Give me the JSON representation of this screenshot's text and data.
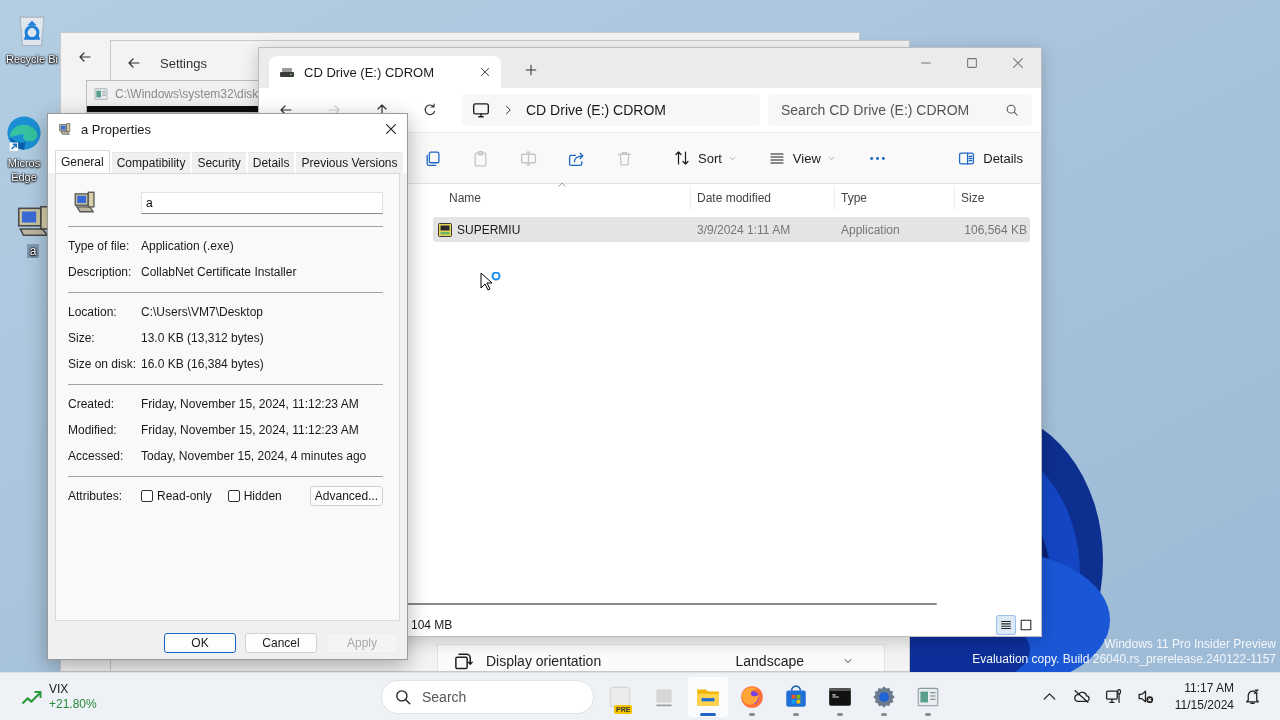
{
  "desktop_icons": [
    {
      "kind": "recycle",
      "label": "Recycle Bi"
    },
    {
      "kind": "edge",
      "label": "Micros Edge"
    },
    {
      "kind": "computer",
      "label": "a"
    }
  ],
  "settings_window": {
    "title": "Settings",
    "setting_row": {
      "label": "Display orientation",
      "value": "Landscape"
    }
  },
  "console_window": {
    "title": "C:\\Windows\\system32\\disk"
  },
  "explorer": {
    "tabs": [
      {
        "title": "CD Drive (E:) CDROM",
        "selected": true
      }
    ],
    "nav": [
      {
        "kind": "back",
        "disabled": false
      },
      {
        "kind": "forward",
        "disabled": true
      },
      {
        "kind": "up",
        "disabled": false
      },
      {
        "kind": "refresh",
        "disabled": false
      }
    ],
    "address": "CD Drive (E:) CDROM",
    "search": {
      "placeholder": "Search CD Drive (E:) CDROM"
    },
    "toolbar": [
      {
        "kind": "copy",
        "disabled": false
      },
      {
        "kind": "paste",
        "disabled": true
      },
      {
        "kind": "rename",
        "disabled": true
      },
      {
        "kind": "share",
        "disabled": false
      },
      {
        "kind": "delete",
        "disabled": true
      },
      {
        "kind": "sort",
        "label": "Sort",
        "disabled": false
      },
      {
        "kind": "view",
        "label": "View",
        "disabled": false
      },
      {
        "kind": "more",
        "disabled": false
      }
    ],
    "details_button": "Details",
    "columns": [
      "Name",
      "Date modified",
      "Type",
      "Size"
    ],
    "rows": [
      {
        "name": "SUPERMIU",
        "date": "3/9/2024 1:11 AM",
        "type": "Application",
        "size": "106,564 KB",
        "selected": true
      }
    ],
    "status_bar": "104 MB",
    "view_modes": [
      {
        "kind": "details",
        "selected": true
      },
      {
        "kind": "tiles",
        "selected": false
      }
    ]
  },
  "properties": {
    "title": "a Properties",
    "tabs": [
      {
        "label": "General",
        "selected": true
      },
      {
        "label": "Compatibility",
        "selected": false
      },
      {
        "label": "Security",
        "selected": false
      },
      {
        "label": "Details",
        "selected": false
      },
      {
        "label": "Previous Versions",
        "selected": false
      }
    ],
    "name": "a",
    "groups": [
      [
        {
          "label": "Type of file:",
          "value": "Application (.exe)"
        },
        {
          "label": "Description:",
          "value": "CollabNet Certificate Installer"
        }
      ],
      [
        {
          "label": "Location:",
          "value": "C:\\Users\\VM7\\Desktop"
        },
        {
          "label": "Size:",
          "value": "13.0 KB (13,312 bytes)"
        },
        {
          "label": "Size on disk:",
          "value": "16.0 KB (16,384 bytes)"
        }
      ],
      [
        {
          "label": "Created:",
          "value": "Friday, November 15, 2024, 11:12:23 AM"
        },
        {
          "label": "Modified:",
          "value": "Friday, November 15, 2024, 11:12:23 AM"
        },
        {
          "label": "Accessed:",
          "value": "Today, November 15, 2024, 4 minutes ago"
        }
      ]
    ],
    "attributes": {
      "label": "Attributes:",
      "options": [
        {
          "label": "Read-only",
          "checked": false
        },
        {
          "label": "Hidden",
          "checked": false
        }
      ],
      "advanced": "Advanced..."
    },
    "buttons": [
      {
        "label": "OK",
        "focused": true,
        "disabled": false
      },
      {
        "label": "Cancel",
        "focused": false,
        "disabled": false
      },
      {
        "label": "Apply",
        "focused": false,
        "disabled": true
      }
    ]
  },
  "watermark": [
    "Windows 11 Pro Insider Preview",
    "Evaluation copy. Build 26040.rs_prerelease.240122-1157"
  ],
  "taskbar": {
    "widget": {
      "name": "VIX",
      "change": "+21.80%"
    },
    "search": {
      "placeholder": "Search"
    },
    "apps": [
      {
        "kind": "pre",
        "badge": "PRE",
        "running": false,
        "active": false
      },
      {
        "kind": "taskview",
        "running": false,
        "active": false
      },
      {
        "kind": "explorer",
        "running": true,
        "active": true
      },
      {
        "kind": "firefox",
        "running": true,
        "active": false
      },
      {
        "kind": "store",
        "running": true,
        "active": false
      },
      {
        "kind": "terminal",
        "running": true,
        "active": false
      },
      {
        "kind": "settings",
        "running": true,
        "active": false
      },
      {
        "kind": "app",
        "running": true,
        "active": false
      }
    ],
    "time": "11:17 AM",
    "date": "11/15/2024"
  }
}
